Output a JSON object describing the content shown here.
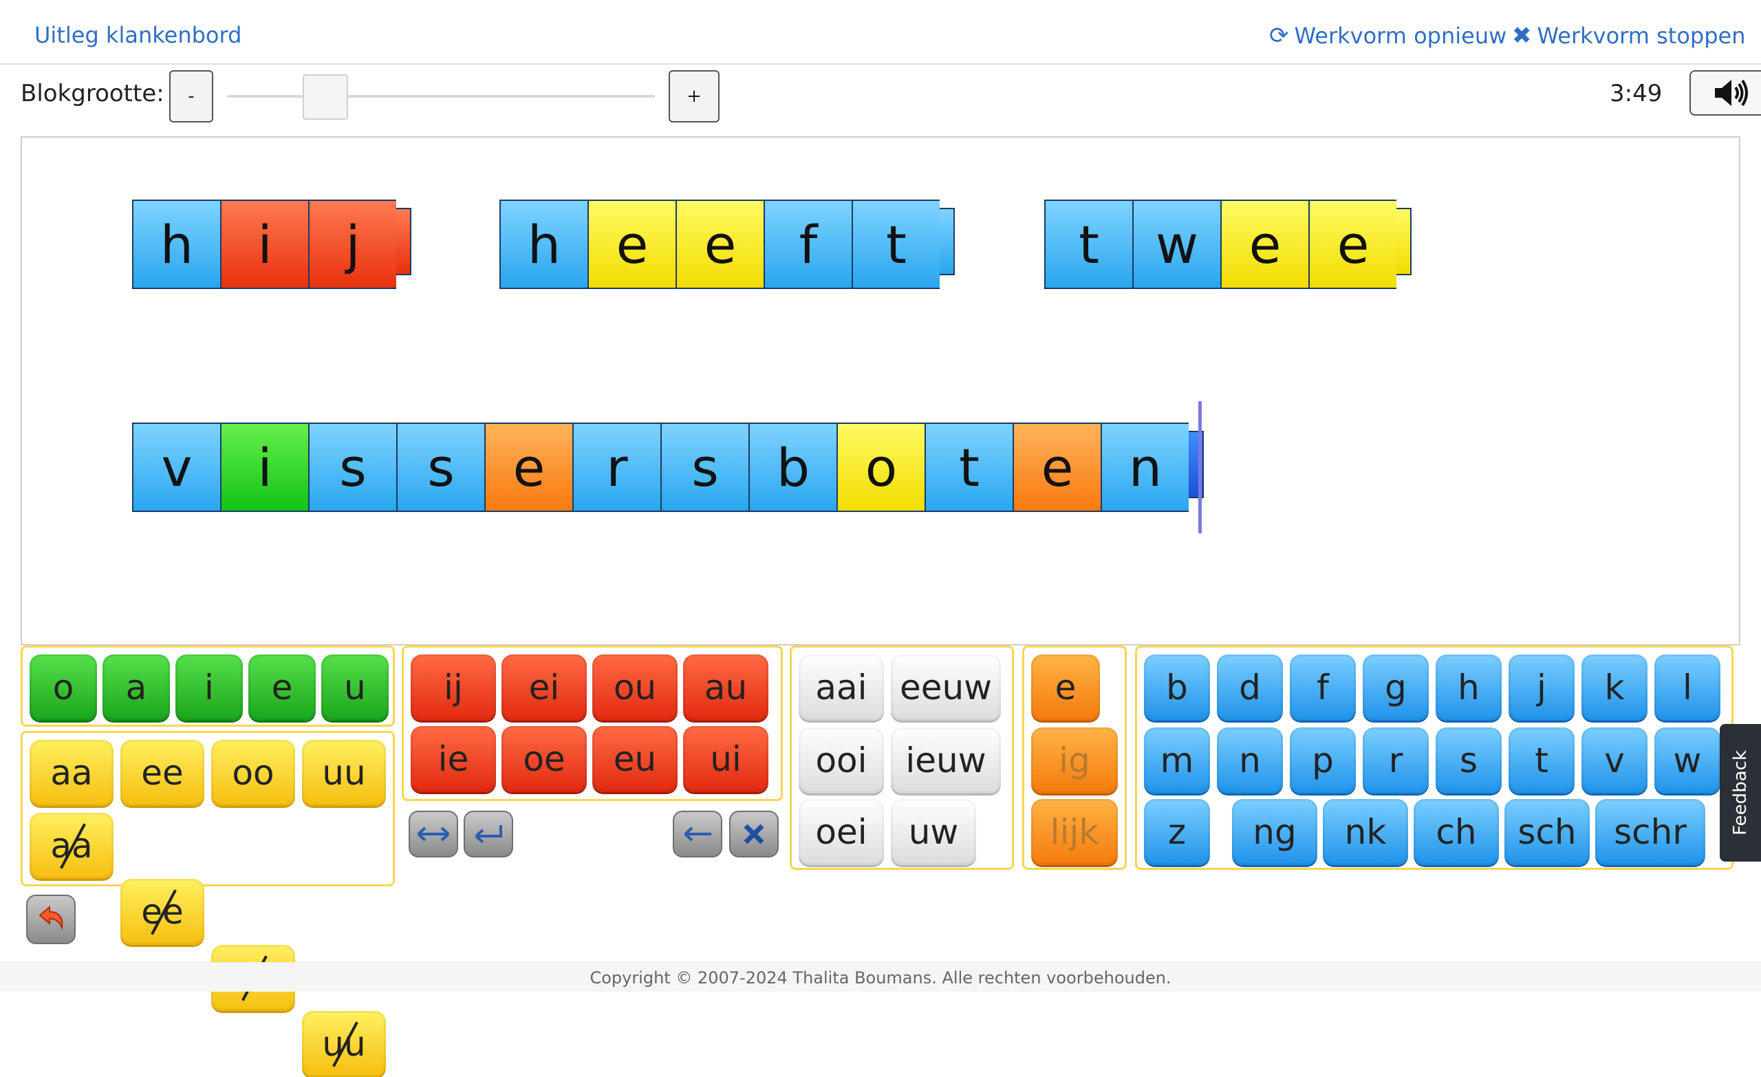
{
  "topbar": {
    "uitleg_label": "Uitleg klankenbord",
    "restart_label": "Werkvorm opnieuw",
    "stop_label": "Werkvorm stoppen"
  },
  "toolbar": {
    "block_size_label": "Blokgrootte:",
    "minus_label": "-",
    "plus_label": "+",
    "timer": "3:49"
  },
  "board": {
    "words": [
      {
        "letters": [
          [
            "h",
            "blue"
          ],
          [
            "i",
            "red"
          ],
          [
            "j",
            "red"
          ]
        ],
        "tab": "red"
      },
      {
        "letters": [
          [
            "h",
            "blue"
          ],
          [
            "e",
            "yellow"
          ],
          [
            "e",
            "yellow"
          ],
          [
            "f",
            "blue"
          ],
          [
            "t",
            "blue"
          ]
        ],
        "tab": "blue"
      },
      {
        "letters": [
          [
            "t",
            "blue"
          ],
          [
            "w",
            "blue"
          ],
          [
            "e",
            "yellow"
          ],
          [
            "e",
            "yellow"
          ]
        ],
        "tab": "yellow"
      },
      {
        "letters": [
          [
            "v",
            "blue"
          ],
          [
            "i",
            "green"
          ],
          [
            "s",
            "blue"
          ],
          [
            "s",
            "blue"
          ],
          [
            "e",
            "orange"
          ],
          [
            "r",
            "blue"
          ],
          [
            "s",
            "blue"
          ],
          [
            "b",
            "blue"
          ],
          [
            "o",
            "yellow"
          ],
          [
            "t",
            "blue"
          ],
          [
            "e",
            "orange"
          ],
          [
            "n",
            "blue"
          ]
        ],
        "tab": "blue-dark"
      }
    ]
  },
  "keyboard": {
    "vowels_short": [
      "o",
      "a",
      "i",
      "e",
      "u"
    ],
    "vowels_long": [
      "aa",
      "ee",
      "oo",
      "uu"
    ],
    "vowels_struck": [
      "aa",
      "ee",
      "oo",
      "uu"
    ],
    "diphthongs": [
      "ij",
      "ei",
      "ou",
      "au",
      "ie",
      "oe",
      "eu",
      "ui"
    ],
    "clusters": [
      "aai",
      "eeuw",
      "ooi",
      "ieuw",
      "oei",
      "uw"
    ],
    "endings": [
      "e",
      "ig",
      "lijk"
    ],
    "consonants_row1": [
      "b",
      "d",
      "f",
      "g",
      "h",
      "j",
      "k",
      "l"
    ],
    "consonants_row2": [
      "m",
      "n",
      "p",
      "r",
      "s",
      "t",
      "v",
      "w"
    ],
    "consonants_row3": [
      "z",
      "ng",
      "nk",
      "ch",
      "sch",
      "schr"
    ]
  },
  "feedback_label": "Feedback",
  "footer_text": "Copyright © 2007-2024 Thalita Boumans. Alle rechten voorbehouden."
}
